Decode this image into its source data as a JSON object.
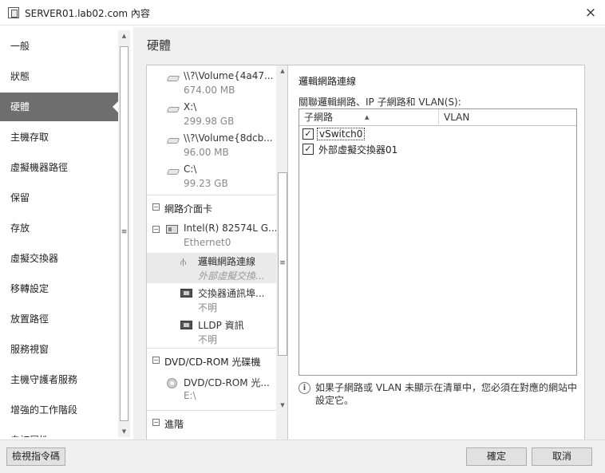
{
  "window": {
    "title": "SERVER01.lab02.com 內容",
    "close_icon": "×"
  },
  "nav": {
    "items": [
      {
        "label": "一般"
      },
      {
        "label": "狀態"
      },
      {
        "label": "硬體",
        "active": true
      },
      {
        "label": "主機存取"
      },
      {
        "label": "虛擬機器路徑"
      },
      {
        "label": "保留"
      },
      {
        "label": "存放"
      },
      {
        "label": "虛擬交換器"
      },
      {
        "label": "移轉設定"
      },
      {
        "label": "放置路徑"
      },
      {
        "label": "服務視窗"
      },
      {
        "label": "主機守護者服務"
      },
      {
        "label": "增強的工作階段"
      },
      {
        "label": "自訂屬性"
      }
    ]
  },
  "main": {
    "section_title": "硬體",
    "tree": {
      "volumes": [
        {
          "name": "\\\\?\\Volume{4a47...",
          "size": "674.00 MB"
        },
        {
          "name": "X:\\",
          "size": "299.98 GB"
        },
        {
          "name": "\\\\?\\Volume{8dcb...",
          "size": "96.00 MB"
        },
        {
          "name": "C:\\",
          "size": "99.23 GB"
        }
      ],
      "nic_section": "網路介面卡",
      "nic": {
        "name": "Intel(R) 82574L G...",
        "sub": "Ethernet0"
      },
      "nic_children": [
        {
          "name": "邏輯網路連線",
          "sub": "外部虛擬交換...",
          "selected": true,
          "icon": "network-icon"
        },
        {
          "name": "交換器通訊埠...",
          "sub": "不明",
          "icon": "port-icon"
        },
        {
          "name": "LLDP 資訊",
          "sub": "不明",
          "icon": "port-icon"
        }
      ],
      "dvd_section": "DVD/CD-ROM 光碟機",
      "dvd": {
        "name": "DVD/CD-ROM 光...",
        "sub": "E:\\"
      },
      "next_section": "進階"
    },
    "detail": {
      "heading": "邏輯網路連線",
      "subheading": "關聯邏輯網路、IP 子網路和 VLAN(S):",
      "columns": [
        "子網路",
        "VLAN"
      ],
      "rows": [
        {
          "label": "vSwitch0",
          "checked": true,
          "focused": true
        },
        {
          "label": "外部虛擬交換器01",
          "checked": true,
          "focused": false
        }
      ],
      "info_text": "如果子網路或 VLAN 未顯示在清單中，您必須在對應的網站中設定它。"
    }
  },
  "footer": {
    "view_script": "檢視指令碼",
    "ok": "確定",
    "cancel": "取消"
  }
}
